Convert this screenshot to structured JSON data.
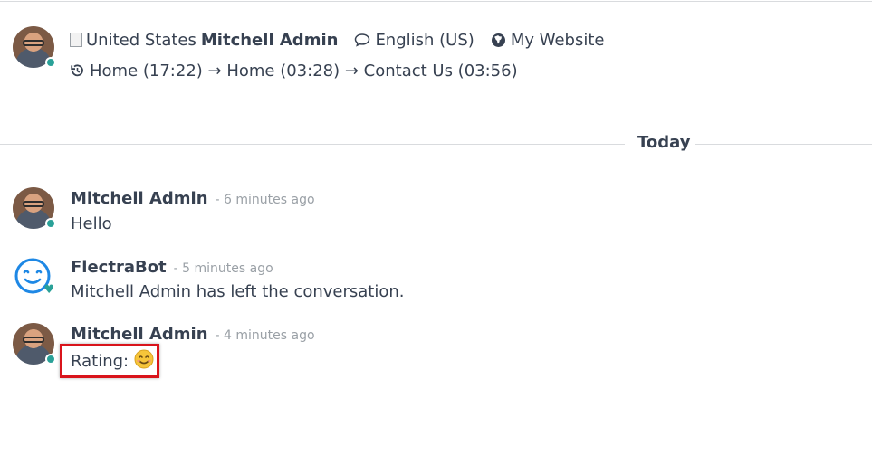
{
  "header": {
    "flag_alt": "United States",
    "visitor_name": "Mitchell Admin",
    "language": "English (US)",
    "website": "My Website",
    "history": "Home (17:22) → Home (03:28) → Contact Us (03:56)"
  },
  "separator": {
    "label": "Today"
  },
  "messages": [
    {
      "author": "Mitchell Admin",
      "time": "- 6 minutes ago",
      "body": "Hello"
    },
    {
      "author": "FlectraBot",
      "time": "- 5 minutes ago",
      "body": "Mitchell Admin has left the conversation."
    },
    {
      "author": "Mitchell Admin",
      "time": "- 4 minutes ago",
      "body": "Rating: "
    }
  ],
  "icons": {
    "chat": "speech-bubble-icon",
    "globe": "globe-icon",
    "history": "history-icon",
    "smiley": "smiley-face-icon"
  },
  "colors": {
    "status_online": "#2aa198",
    "highlight_border": "#d9141b",
    "bot_blue": "#1e88e5"
  }
}
